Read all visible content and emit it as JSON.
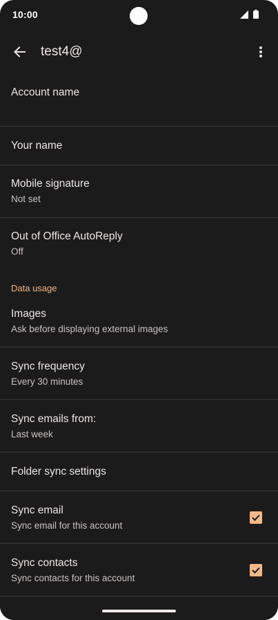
{
  "status_bar": {
    "time": "10:00"
  },
  "app_bar": {
    "title": "test4@",
    "back_icon": "arrow-back-icon",
    "more_icon": "more-vert-icon"
  },
  "colors": {
    "background": "#1c1b1b",
    "accent": "#f5b78a",
    "section_header": "#f2b487"
  },
  "settings": {
    "account_name": {
      "title": "Account name"
    },
    "your_name": {
      "title": "Your name"
    },
    "mobile_signature": {
      "title": "Mobile signature",
      "value": "Not set"
    },
    "out_of_office": {
      "title": "Out of Office AutoReply",
      "value": "Off"
    },
    "data_usage_header": "Data usage",
    "images": {
      "title": "Images",
      "value": "Ask before displaying external images"
    },
    "sync_frequency": {
      "title": "Sync frequency",
      "value": "Every 30 minutes"
    },
    "sync_emails_from": {
      "title": "Sync emails from:",
      "value": "Last week"
    },
    "folder_sync": {
      "title": "Folder sync settings"
    },
    "sync_email": {
      "title": "Sync email",
      "value": "Sync email for this account",
      "checked": true
    },
    "sync_contacts": {
      "title": "Sync contacts",
      "value": "Sync contacts for this account",
      "checked": true
    }
  }
}
